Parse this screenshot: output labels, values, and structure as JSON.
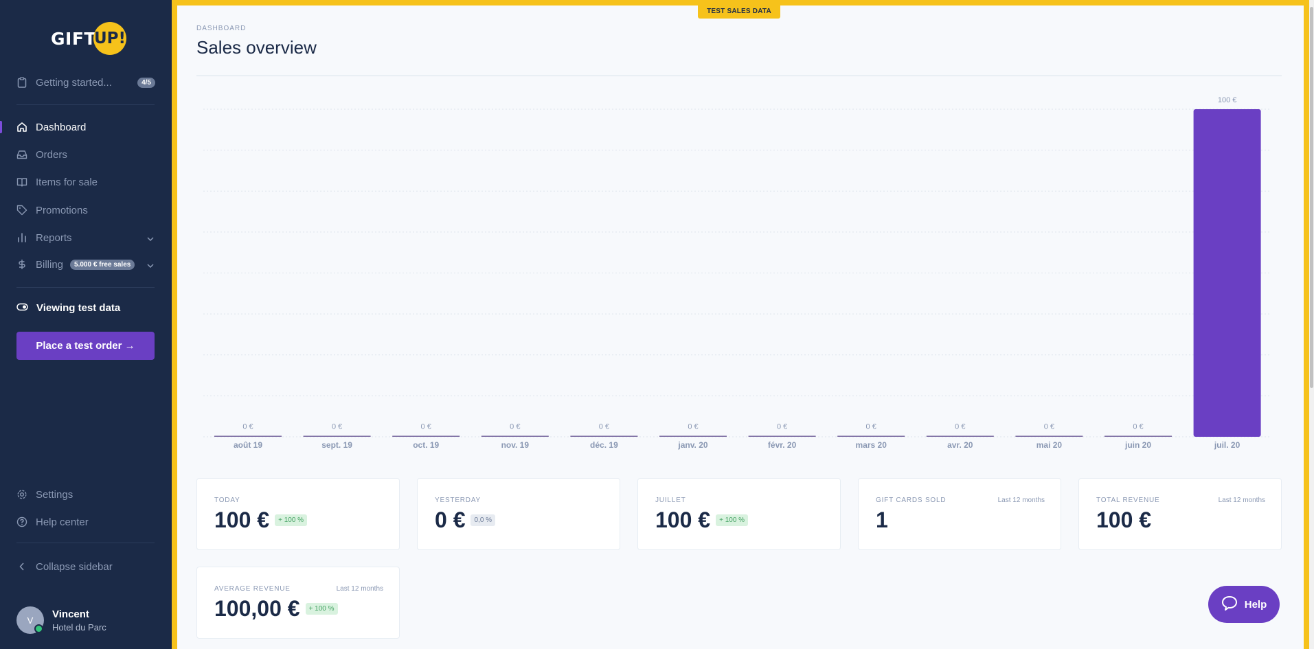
{
  "sidebar": {
    "logo": {
      "left": "GIFT",
      "right": "UP!"
    },
    "getting_started": {
      "label": "Getting started...",
      "badge": "4/5"
    },
    "items": [
      {
        "label": "Dashboard",
        "icon": "home-icon",
        "active": true
      },
      {
        "label": "Orders",
        "icon": "inbox-icon"
      },
      {
        "label": "Items for sale",
        "icon": "book-icon"
      },
      {
        "label": "Promotions",
        "icon": "tag-icon"
      },
      {
        "label": "Reports",
        "icon": "bar-chart-icon"
      },
      {
        "label": "Billing",
        "icon": "dollar-icon",
        "badge": "5.000 € free sales"
      }
    ],
    "viewing_test_data": "Viewing test data",
    "test_order_button": "Place a test order →",
    "settings": "Settings",
    "help_center": "Help center",
    "collapse": "Collapse sidebar",
    "user": {
      "initial": "V",
      "name": "Vincent",
      "org": "Hotel du Parc"
    }
  },
  "main": {
    "test_badge": "TEST SALES DATA",
    "breadcrumb": "DASHBOARD",
    "title": "Sales overview"
  },
  "chart_data": {
    "type": "bar",
    "categories": [
      "août 19",
      "sept. 19",
      "oct. 19",
      "nov. 19",
      "déc. 19",
      "janv. 20",
      "févr. 20",
      "mars 20",
      "avr. 20",
      "mai 20",
      "juin 20",
      "juil. 20"
    ],
    "values": [
      0,
      0,
      0,
      0,
      0,
      0,
      0,
      0,
      0,
      0,
      0,
      100
    ],
    "value_labels": [
      "0 €",
      "0 €",
      "0 €",
      "0 €",
      "0 €",
      "0 €",
      "0 €",
      "0 €",
      "0 €",
      "0 €",
      "0 €",
      "100 €"
    ],
    "ylim": [
      0,
      100
    ],
    "grid": true,
    "bar_color": "#6a3fc3"
  },
  "cards": [
    {
      "label": "TODAY",
      "value": "100 €",
      "badge": "+ 100 %",
      "badge_type": "positive"
    },
    {
      "label": "YESTERDAY",
      "value": "0 €",
      "badge": "0,0 %",
      "badge_type": "neutral"
    },
    {
      "label": "JUILLET",
      "value": "100 €",
      "badge": "+ 100 %",
      "badge_type": "positive"
    },
    {
      "label": "GIFT CARDS SOLD",
      "sub": "Last 12 months",
      "value": "1"
    },
    {
      "label": "TOTAL REVENUE",
      "sub": "Last 12 months",
      "value": "100 €"
    },
    {
      "label": "AVERAGE REVENUE",
      "sub": "Last 12 months",
      "value": "100,00 €",
      "badge": "+ 100 %",
      "badge_type": "positive"
    }
  ],
  "help_button": "Help"
}
